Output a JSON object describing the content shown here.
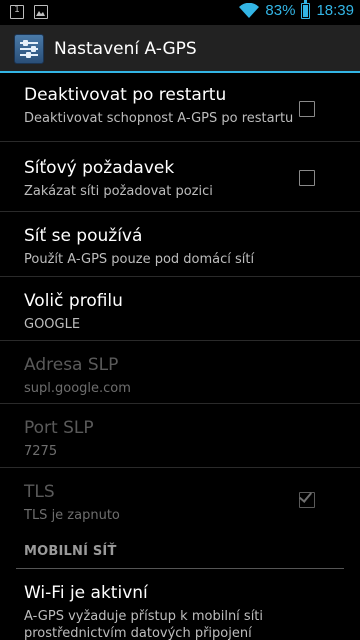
{
  "status_bar": {
    "notif_num": "1",
    "battery_percent": "83%",
    "battery_level": 0.83,
    "time": "18:39",
    "accent_color": "#33b5e5"
  },
  "action_bar": {
    "icon": "settings-sliders-icon",
    "title": "Nastavení A-GPS"
  },
  "preferences": [
    {
      "title": "Deaktivovat po restartu",
      "summary": "Deaktivovat schopnost A-GPS po restartu",
      "checkbox": "unchecked",
      "enabled": true
    },
    {
      "title": "Síťový požadavek",
      "summary": "Zakázat síti požadovat pozici",
      "checkbox": "unchecked",
      "enabled": true
    },
    {
      "title": "Síť se používá",
      "summary": "Použít A-GPS pouze pod domácí sítí",
      "enabled": true
    },
    {
      "title": "Volič profilu",
      "summary": "GOOGLE",
      "enabled": true
    },
    {
      "title": "Adresa SLP",
      "summary": "supl.google.com",
      "enabled": false
    },
    {
      "title": "Port SLP",
      "summary": "7275",
      "enabled": false
    },
    {
      "title": "TLS",
      "summary": "TLS je zapnuto",
      "checkbox": "checked",
      "enabled": false
    }
  ],
  "section_header": "MOBILNÍ SÍŤ",
  "mobile_item": {
    "title": "Wi-Fi je aktivní",
    "summary": "A-GPS vyžaduje přístup k mobilní síti prostřednictvím datových připojení"
  }
}
